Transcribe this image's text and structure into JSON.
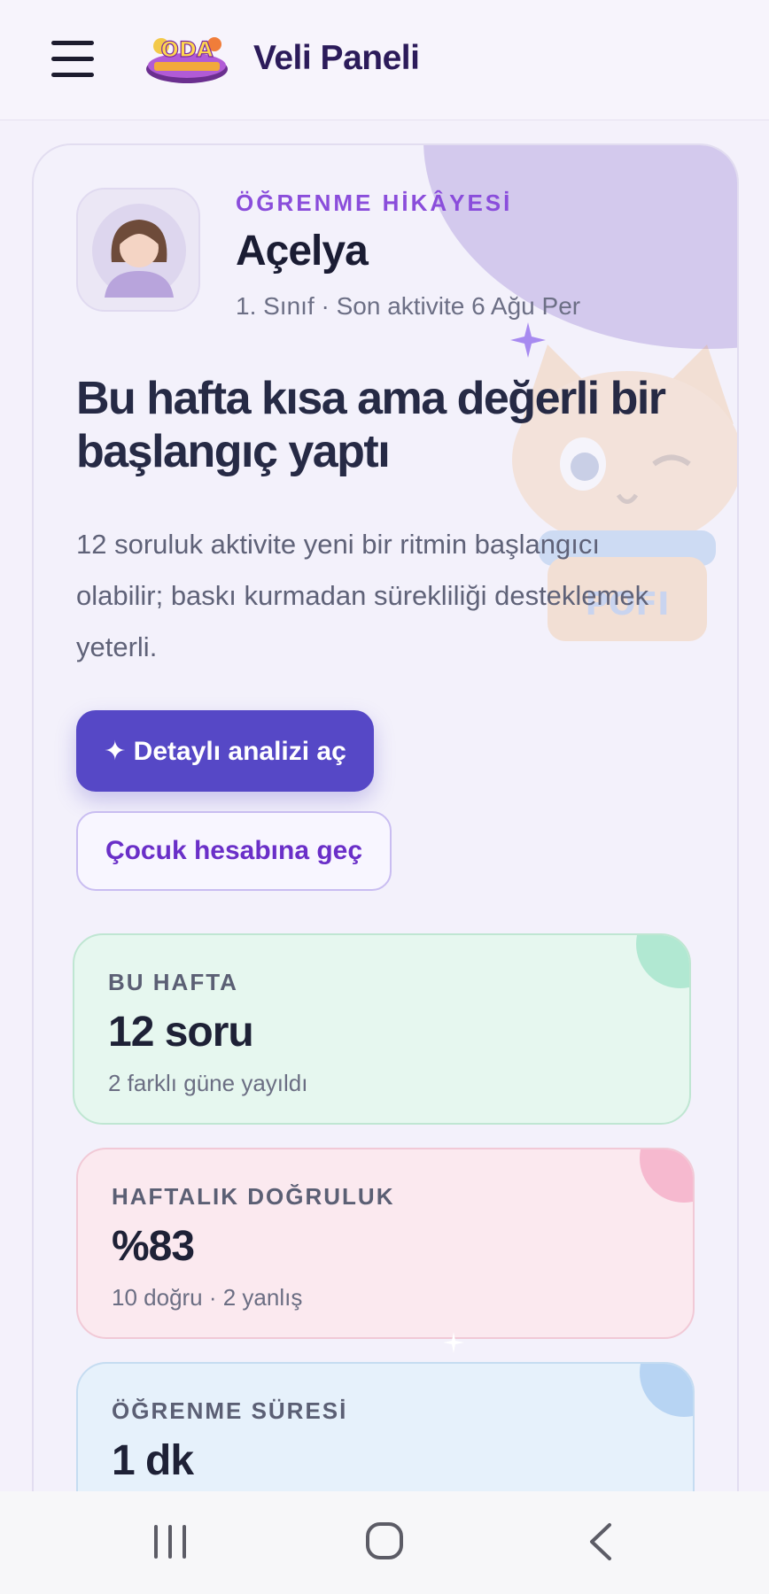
{
  "header": {
    "title": "Veli Paneli",
    "menu_icon": "hamburger-menu-icon",
    "logo_text": "ODA"
  },
  "hero": {
    "eyebrow": "ÖĞRENME HİKÂYESİ",
    "child_name": "Açelya",
    "child_meta": "1. Sınıf · Son aktivite 6 Ağu Per",
    "headline": "Bu hafta kısa ama değerli bir başlangıç yaptı",
    "description": "12 soruluk aktivite yeni bir ritmin başlangıcı olabilir; baskı kurmadan sürekliliği desteklemek yeterli.",
    "mascot_label": "POFI",
    "primary_button": "✦ Detaylı analizi aç",
    "secondary_button": "Çocuk hesabına geç"
  },
  "stats": [
    {
      "label": "BU HAFTA",
      "value": "12 soru",
      "sub": "2 farklı güne yayıldı"
    },
    {
      "label": "HAFTALIK DOĞRULUK",
      "value": "%83",
      "sub": "10 doğru · 2 yanlış"
    },
    {
      "label": "ÖĞRENME SÜRESİ",
      "value": "1 dk",
      "sub": ""
    }
  ],
  "colors": {
    "accent": "#5648c6",
    "eyebrow": "#8a4ddb",
    "week_card": "#e6f7ef",
    "accuracy_card": "#fbe9ef",
    "time_card": "#e6f1fb"
  },
  "system_nav": {
    "recent_icon": "recent-apps-icon",
    "home_icon": "home-icon",
    "back_icon": "back-icon"
  }
}
